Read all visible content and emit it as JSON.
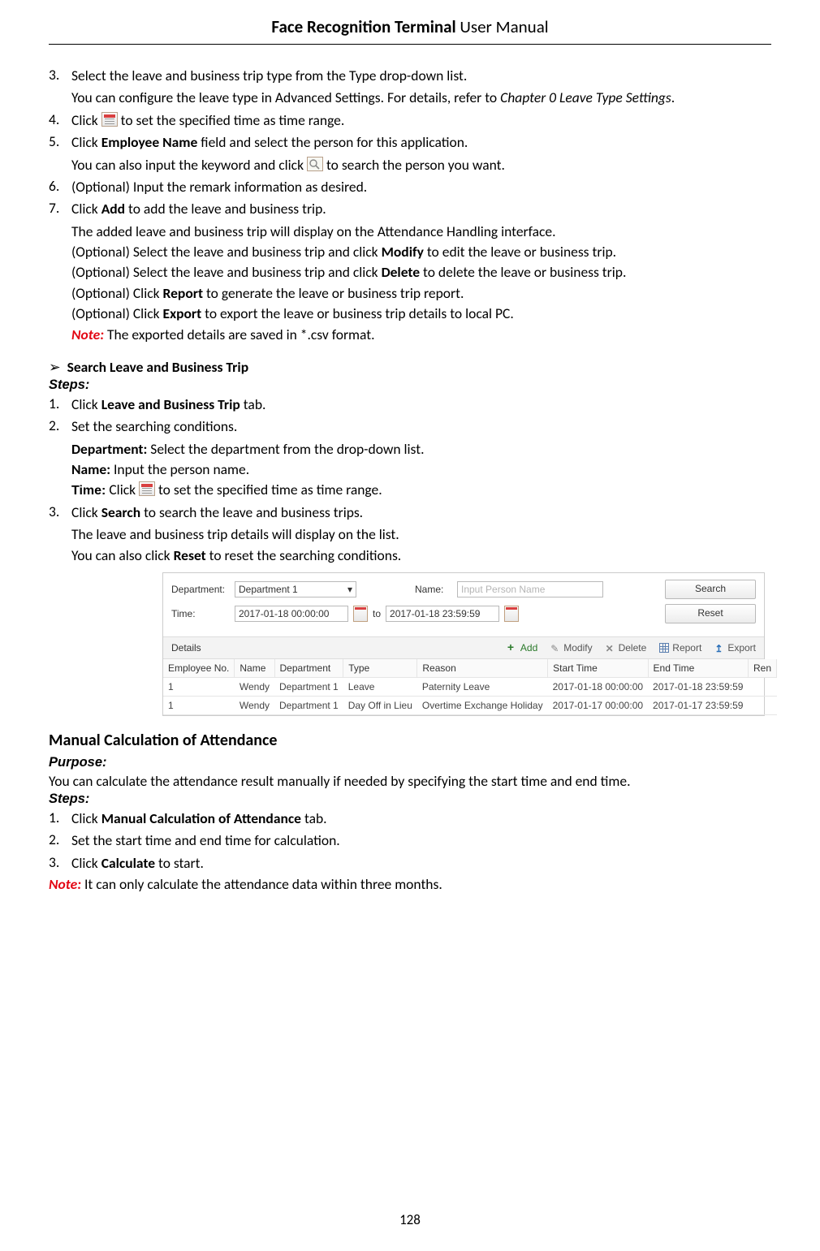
{
  "header": {
    "bold": "Face Recognition Terminal",
    "rest": "  User Manual"
  },
  "page_number": "128",
  "li3": {
    "num": "3.",
    "text": "Select the leave and business trip type from the Type drop-down list."
  },
  "li3_cont_start": "You can configure the leave type in Advanced Settings. For details, refer to ",
  "li3_chapter": "Chapter 0 Leave Type Settings",
  "li3_cont_end": ".",
  "li4": {
    "num": "4.",
    "pre": "Click ",
    "post": " to set the specified time as time range."
  },
  "li5": {
    "num": "5.",
    "pre": "Click ",
    "bold": "Employee Name",
    "post": " field and select the person for this application."
  },
  "li5_cont_pre": "You can also input the keyword and click ",
  "li5_cont_post": " to search the person you want.",
  "li6": {
    "num": "6.",
    "text": "(Optional) Input the remark information as desired."
  },
  "li7": {
    "num": "7.",
    "pre": "Click ",
    "bold": "Add",
    "post": " to add the leave and business trip."
  },
  "li7_line2": "The added leave and business trip will display on the Attendance Handling interface.",
  "li7_line3_pre": "(Optional) Select the leave and business trip and click ",
  "li7_line3_bold": "Modify",
  "li7_line3_post": " to edit the leave or business trip.",
  "li7_line4_pre": "(Optional) Select the leave and business trip and click ",
  "li7_line4_bold": "Delete",
  "li7_line4_post": " to delete the leave or business trip.",
  "li7_line5_pre": "(Optional) Click ",
  "li7_line5_bold": "Report",
  "li7_line5_post": " to generate the leave or business trip report.",
  "li7_line6_pre": "(Optional) Click ",
  "li7_line6_bold": "Export",
  "li7_line6_post": " to export the leave or business trip details to local PC.",
  "li7_note_label": "Note:",
  "li7_note_text": " The exported details are saved in *.csv format.",
  "search_bullet": "Search Leave and Business Trip",
  "steps_label": "Steps:",
  "s1": {
    "num": "1.",
    "pre": "Click ",
    "bold": "Leave and Business Trip",
    "post": " tab."
  },
  "s2": {
    "num": "2.",
    "text": "Set the searching conditions."
  },
  "s2_dept_b": "Department:",
  "s2_dept_t": " Select the department from the drop-down list.",
  "s2_name_b": "Name:",
  "s2_name_t": " Input the person name.",
  "s2_time_b": "Time:",
  "s2_time_pre": " Click ",
  "s2_time_post": " to set the specified time as time range.",
  "s3": {
    "num": "3.",
    "pre": "Click ",
    "bold": "Search",
    "post": " to search the leave and business trips."
  },
  "s3_line2": "The leave and business trip details will display on the list.",
  "s3_line3_pre": "You can also click ",
  "s3_line3_bold": "Reset",
  "s3_line3_post": " to reset the searching conditions.",
  "ui": {
    "filters": {
      "dept_label": "Department:",
      "dept_value": "Department 1",
      "name_label": "Name:",
      "name_placeholder": "Input Person Name",
      "time_label": "Time:",
      "time_from": "2017-01-18 00:00:00",
      "time_to_lbl": "to",
      "time_to": "2017-01-18 23:59:59",
      "search_btn": "Search",
      "reset_btn": "Reset"
    },
    "toolbar": {
      "details": "Details",
      "add": "Add",
      "modify": "Modify",
      "delete": "Delete",
      "report": "Report",
      "export": "Export"
    },
    "columns": {
      "emp": "Employee No.",
      "name": "Name",
      "dept": "Department",
      "type": "Type",
      "reason": "Reason",
      "start": "Start Time",
      "end": "End Time",
      "rem": "Ren"
    },
    "rows": [
      {
        "emp": "1",
        "name": "Wendy",
        "dept": "Department 1",
        "type": "Leave",
        "reason": "Paternity Leave",
        "start": "2017-01-18 00:00:00",
        "end": "2017-01-18 23:59:59"
      },
      {
        "emp": "1",
        "name": "Wendy",
        "dept": "Department 1",
        "type": "Day Off in Lieu",
        "reason": "Overtime Exchange Holiday",
        "start": "2017-01-17 00:00:00",
        "end": "2017-01-17 23:59:59"
      }
    ]
  },
  "manual_heading": "Manual Calculation of Attendance",
  "purpose_label": "Purpose:",
  "purpose_text": "You can calculate the attendance result manually if needed by specifying the start time and end time.",
  "m1": {
    "num": "1.",
    "pre": "Click ",
    "bold": "Manual Calculation of Attendance",
    "post": " tab."
  },
  "m2": {
    "num": "2.",
    "text": "Set the start time and end time for calculation."
  },
  "m3": {
    "num": "3.",
    "pre": "Click ",
    "bold": "Calculate",
    "post": " to start."
  },
  "m_note_label": "Note:",
  "m_note_text": " It can only calculate the attendance data within three months."
}
